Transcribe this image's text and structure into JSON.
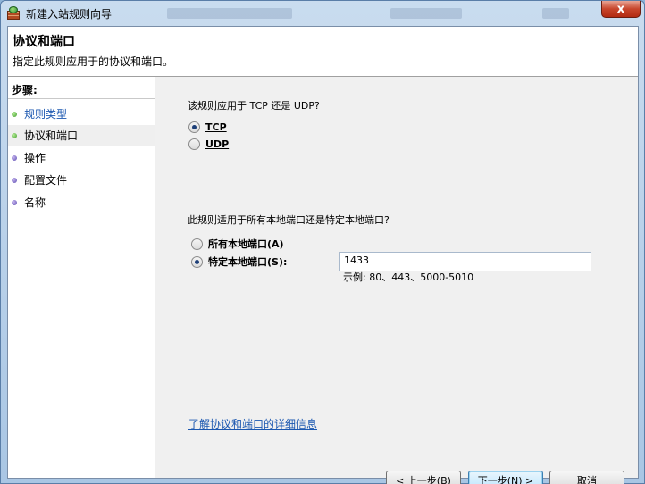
{
  "window": {
    "title": "新建入站规则向导",
    "close_label": "x"
  },
  "header": {
    "title": "协议和端口",
    "subtitle": "指定此规则应用于的协议和端口。"
  },
  "sidebar": {
    "steps_label": "步骤:",
    "items": [
      {
        "label": "规则类型"
      },
      {
        "label": "协议和端口"
      },
      {
        "label": "操作"
      },
      {
        "label": "配置文件"
      },
      {
        "label": "名称"
      }
    ]
  },
  "content": {
    "protocol_question": "该规则应用于 TCP 还是 UDP?",
    "tcp_label": "TCP",
    "udp_label": "UDP",
    "port_question": "此规则适用于所有本地端口还是特定本地端口?",
    "all_ports_label": "所有本地端口(A)",
    "specific_ports_label": "特定本地端口(S):",
    "port_value": "1433",
    "example_text": "示例: 80、443、5000-5010",
    "info_link": "了解协议和端口的详细信息"
  },
  "buttons": {
    "back": "< 上一步(B)",
    "next": "下一步(N) >",
    "cancel": "取消"
  }
}
